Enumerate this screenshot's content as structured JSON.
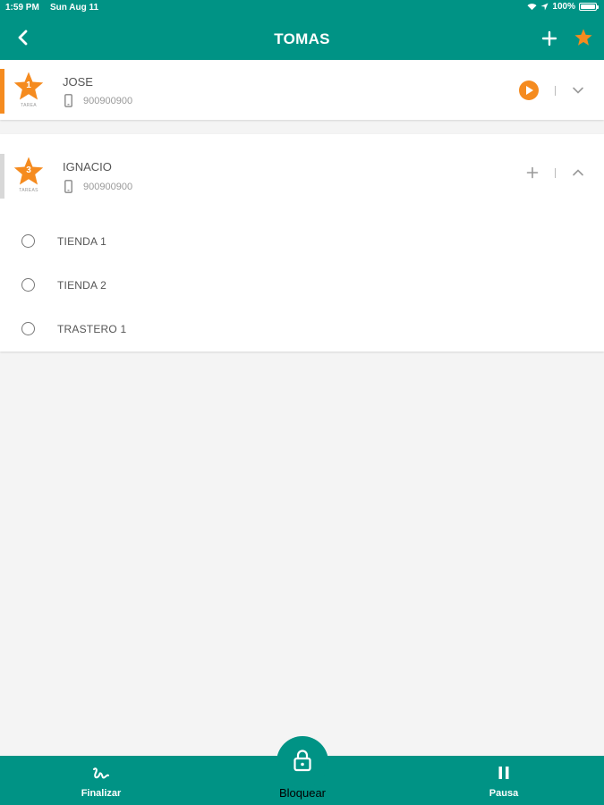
{
  "status_bar": {
    "time": "1:59 PM",
    "date": "Sun Aug 11",
    "battery": "100%"
  },
  "header": {
    "title": "TOMAS",
    "add_icon": "plus-icon",
    "fav_icon": "star-icon",
    "back_icon": "chevron-left-icon"
  },
  "colors": {
    "primary": "#009385",
    "accent": "#f58b1f",
    "muted_accent": "#d8d8d8"
  },
  "contacts": [
    {
      "number": "1",
      "tag": "TAREA",
      "name": "JOSE",
      "phone": "900900900",
      "action_icon": "play-icon",
      "expand_icon": "chevron-down-icon",
      "expanded": false
    },
    {
      "number": "3",
      "tag": "TAREAS",
      "name": "IGNACIO",
      "phone": "900900900",
      "action_icon": "plus-icon",
      "expand_icon": "chevron-up-icon",
      "expanded": true,
      "items": [
        {
          "label": "TIENDA 1"
        },
        {
          "label": "TIENDA 2"
        },
        {
          "label": "TRASTERO 1"
        }
      ]
    }
  ],
  "bottom_bar": {
    "finalizar": "Finalizar",
    "bloquear": "Bloquear",
    "pausa": "Pausa"
  }
}
